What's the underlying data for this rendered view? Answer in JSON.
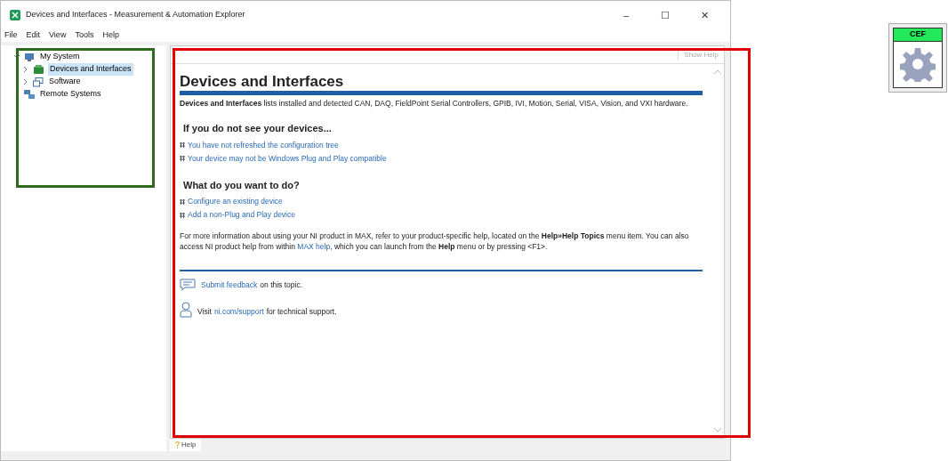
{
  "window": {
    "title": "Devices and Interfaces - Measurement & Automation Explorer",
    "controls": [
      "–",
      "☐",
      "✕"
    ]
  },
  "menu": [
    "File",
    "Edit",
    "View",
    "Tools",
    "Help"
  ],
  "tree": [
    {
      "label": "My System",
      "expanded": true,
      "selected": false,
      "children": [
        {
          "label": "Devices and Interfaces",
          "expanded": false,
          "selected": true
        },
        {
          "label": "Software",
          "expanded": false,
          "selected": false
        }
      ]
    },
    {
      "label": "Remote Systems",
      "selected": false
    }
  ],
  "help": {
    "show_help": "Show Help",
    "title": "Devices and Interfaces",
    "intro": "**Devices and Interfaces** lists installed and detected CAN, DAQ, FieldPoint Serial Controllers, GPIB, IVI, Motion, Serial, VISA, Vision, and VXI hardware.",
    "sections": [
      {
        "heading": "If you do not see your devices...",
        "links": [
          "You have not refreshed the configuration tree",
          "Your device may not be Windows Plug and Play compatible"
        ]
      },
      {
        "heading": "What do you want to do?",
        "links": [
          "Configure an existing device",
          "Add a non-Plug and Play device"
        ]
      }
    ],
    "info": [
      {
        "kind": "text",
        "text": "For more information about using your NI product in MAX, refer to your product-specific help, located on the **Help»Help Topics** menu item. You can also access NI product help from within"
      },
      {
        "kind": "link",
        "text": "MAX help"
      },
      {
        "kind": "text",
        "text": ", which you can launch from the **Help** menu or by pressing <F1>."
      }
    ],
    "footer": [
      {
        "parts": [
          {
            "kind": "link",
            "text": "Submit feedback"
          },
          {
            "kind": "text",
            "text": "on this topic."
          }
        ]
      },
      {
        "parts": [
          {
            "kind": "text",
            "text": "Visit"
          },
          {
            "kind": "link",
            "text": "ni.com/support"
          },
          {
            "kind": "text",
            "text": "for technical support."
          }
        ]
      }
    ]
  },
  "bottom_tab": "Help",
  "badge": {
    "label": "CEF"
  }
}
